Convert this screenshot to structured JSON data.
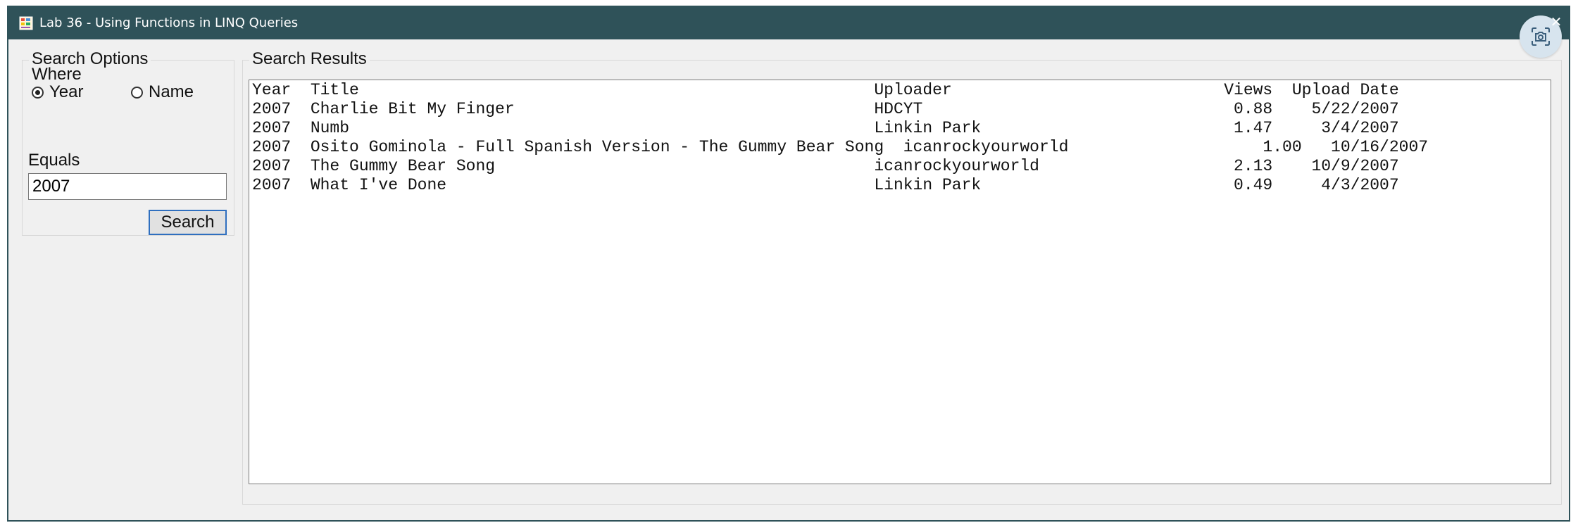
{
  "window": {
    "title": "Lab 36 - Using Functions in LINQ Queries",
    "close_glyph": "✕"
  },
  "search_options": {
    "legend": "Search Options",
    "where_label": "Where",
    "options": [
      {
        "label": "Year",
        "checked": true
      },
      {
        "label": "Name",
        "checked": false
      }
    ],
    "equals_label": "Equals",
    "equals_value": "2007",
    "search_button": "Search"
  },
  "search_results": {
    "legend": "Search Results",
    "lines": [
      "Year  Title                                                     Uploader                            Views  Upload Date",
      "2007  Charlie Bit My Finger                                     HDCYT                                0.88    5/22/2007",
      "2007  Numb                                                      Linkin Park                          1.47     3/4/2007",
      "2007  Osito Gominola - Full Spanish Version - The Gummy Bear Song  icanrockyourworld                    1.00   10/16/2007",
      "2007  The Gummy Bear Song                                       icanrockyourworld                    2.13    10/9/2007",
      "2007  What I've Done                                            Linkin Park                          0.49     4/3/2007"
    ]
  },
  "icons": {
    "app": "windows-form-icon",
    "close": "close-icon",
    "capture": "screen-capture-icon"
  },
  "colors": {
    "titlebar": "#2f5259",
    "window_bg": "#f0f0f0",
    "button_focus_border": "#2f6fbf",
    "capture_bg": "#d7e4ee"
  }
}
